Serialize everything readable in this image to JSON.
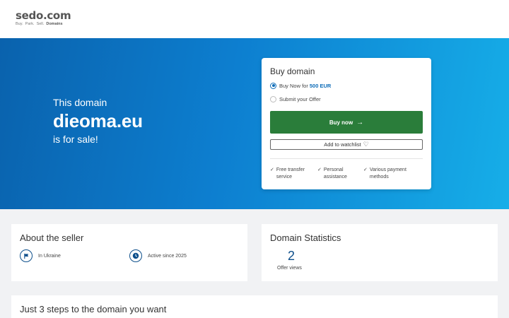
{
  "header": {
    "logo": "sedo.com",
    "tagline": [
      "Buy.",
      "Park.",
      "Sell."
    ],
    "tagline_bold": "Domains"
  },
  "hero": {
    "pre": "This domain",
    "domain": "dieoma.eu",
    "post": "is for sale!"
  },
  "buy_card": {
    "title": "Buy domain",
    "option_buy_label": "Buy Now for",
    "option_buy_price": "500 EUR",
    "option_offer_label": "Submit your Offer",
    "selected_option": "buy_now",
    "buy_button_label": "Buy now",
    "watchlist_label": "Add to watchlist",
    "features": [
      {
        "line1": "Free transfer",
        "line2": "service"
      },
      {
        "line1": "Personal",
        "line2": "assistance"
      },
      {
        "line1": "Various payment",
        "line2": "methods"
      }
    ]
  },
  "seller": {
    "title": "About the seller",
    "location": "In Ukraine",
    "active_since": "Active since 2025"
  },
  "stats": {
    "title": "Domain Statistics",
    "offer_views": "2",
    "offer_views_label": "Offer views"
  },
  "steps": {
    "title": "Just 3 steps to the domain you want"
  },
  "colors": {
    "accent_blue": "#0d6cb8",
    "buy_green": "#2a7d3a",
    "dark_blue": "#0d4f8b"
  }
}
